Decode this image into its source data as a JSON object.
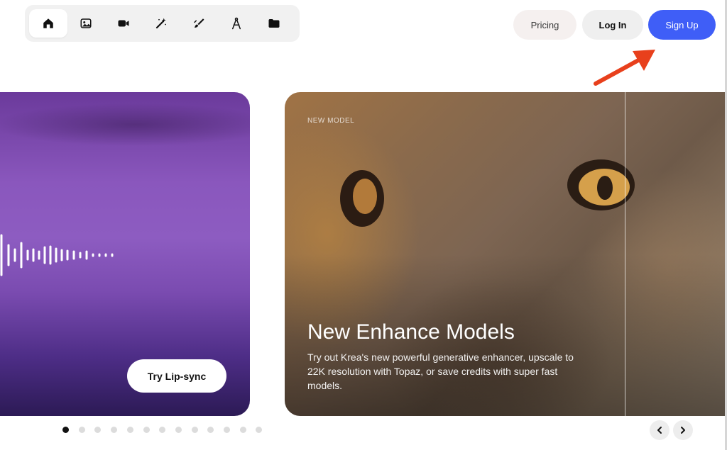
{
  "toolbar": {
    "tools": [
      {
        "icon": "home-icon",
        "active": true
      },
      {
        "icon": "image-icon",
        "active": false
      },
      {
        "icon": "video-icon",
        "active": false
      },
      {
        "icon": "magic-wand-icon",
        "active": false
      },
      {
        "icon": "brush-icon",
        "active": false
      },
      {
        "icon": "compass-icon",
        "active": false
      },
      {
        "icon": "folder-icon",
        "active": false
      }
    ]
  },
  "header": {
    "pricing_label": "Pricing",
    "login_label": "Log In",
    "signup_label": "Sign Up"
  },
  "colors": {
    "accent": "#3f5ef7",
    "arrow": "#e8401c"
  },
  "slides": {
    "left": {
      "button_label": "Try Lip-sync"
    },
    "right": {
      "badge": "NEW MODEL",
      "title": "New Enhance Models",
      "description": "Try out Krea's new powerful generative enhancer, upscale to 22K resolution with Topaz, or save credits with super fast models."
    }
  },
  "pagination": {
    "count": 13,
    "active_index": 0
  },
  "carousel_nav": {
    "prev_icon": "chevron-left-icon",
    "next_icon": "chevron-right-icon"
  }
}
